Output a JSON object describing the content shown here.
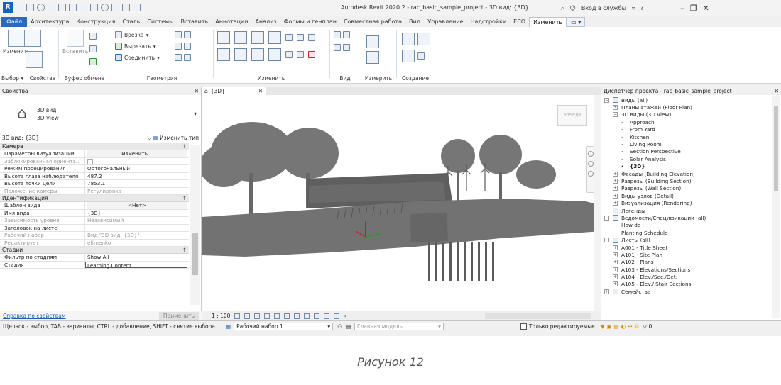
{
  "window": {
    "title": "Autodesk Revit 2020.2 - rac_basic_sample_project - 3D вид: {3D}",
    "signin": "Вход в службы",
    "help": "?"
  },
  "ribbon": {
    "tabs": [
      "Файл",
      "Архитектура",
      "Конструкция",
      "Сталь",
      "Системы",
      "Вставить",
      "Аннотации",
      "Анализ",
      "Формы и генплан",
      "Совместная работа",
      "Вид",
      "Управление",
      "Надстройки",
      "ECO",
      "Изменить"
    ],
    "active_tab": "Изменить",
    "select": {
      "modify_label": "Изменить",
      "group_label": "Выбор",
      "dropdown": "▾"
    },
    "properties_group": "Свойства",
    "clipboard": {
      "paste_label": "Вставить",
      "group_label": "Буфер обмена"
    },
    "geometry": {
      "cope": "Врезка",
      "cut": "Вырезать",
      "join": "Соединить",
      "group_label": "Геометрия"
    },
    "modify_group": "Изменить",
    "view_group": "Вид",
    "measure_group": "Измерить",
    "create_group": "Создание"
  },
  "properties": {
    "header": "Свойства",
    "type_name_1": "3D вид",
    "type_name_2": "3D View",
    "selector": "3D вид: {3D}",
    "edit_type": "Изменить тип",
    "sections": [
      {
        "name": "Камера",
        "rows": [
          {
            "key": "Параметры визуализации",
            "value": "Изменить...",
            "style": "button"
          },
          {
            "key": "Заблокированная ориента...",
            "value": "",
            "style": "checkbox",
            "gray": true
          },
          {
            "key": "Режим проецирования",
            "value": "Ортогональный"
          },
          {
            "key": "Высота глаза наблюдателя",
            "value": "487.2"
          },
          {
            "key": "Высота точки цели",
            "value": "7853.1"
          },
          {
            "key": "Положение камеры",
            "value": "Регулировка",
            "gray": true
          }
        ]
      },
      {
        "name": "Идентификация",
        "rows": [
          {
            "key": "Шаблон вида",
            "value": "<Нет>",
            "style": "button"
          },
          {
            "key": "Имя вида",
            "value": "{3D}"
          },
          {
            "key": "Зависимость уровня",
            "value": "Независимый",
            "gray": true
          },
          {
            "key": "Заголовок на листе",
            "value": ""
          },
          {
            "key": "Рабочий набор",
            "value": "Вид \"3D вид: {3D}\"",
            "gray": true
          },
          {
            "key": "Редактирует",
            "value": "efimenko",
            "gray": true
          }
        ]
      },
      {
        "name": "Стадии",
        "rows": [
          {
            "key": "Фильтр по стадиям",
            "value": "Show All"
          },
          {
            "key": "Стадия",
            "value": "Learning Content",
            "style": "box"
          }
        ]
      }
    ],
    "help_link": "Справка по свойствам",
    "apply": "Применить"
  },
  "view": {
    "tab_title": "{3D}",
    "scale": "1 : 100",
    "viewcube_label": "ВПЕРЕДИ"
  },
  "browser": {
    "header": "Диспетчер проекта - rac_basic_sample_project",
    "items": [
      {
        "label": "Виды (all)",
        "level": 0,
        "toggle": "−",
        "icon": true
      },
      {
        "label": "Планы этажей (Floor Plan)",
        "level": 1,
        "toggle": "+"
      },
      {
        "label": "3D виды (3D View)",
        "level": 1,
        "toggle": "−"
      },
      {
        "label": "Approach",
        "level": 2
      },
      {
        "label": "From Yard",
        "level": 2
      },
      {
        "label": "Kitchen",
        "level": 2
      },
      {
        "label": "Living Room",
        "level": 2
      },
      {
        "label": "Section Perspective",
        "level": 2
      },
      {
        "label": "Solar Analysis",
        "level": 2
      },
      {
        "label": "{3D}",
        "level": 2,
        "bold": true
      },
      {
        "label": "Фасады (Building Elevation)",
        "level": 1,
        "toggle": "+"
      },
      {
        "label": "Разрезы (Building Section)",
        "level": 1,
        "toggle": "+"
      },
      {
        "label": "Разрезы (Wall Section)",
        "level": 1,
        "toggle": "+"
      },
      {
        "label": "Виды узлов (Detail)",
        "level": 1,
        "toggle": "+"
      },
      {
        "label": "Визуализация (Rendering)",
        "level": 1,
        "toggle": "+"
      },
      {
        "label": "Легенды",
        "level": 0,
        "icon": true
      },
      {
        "label": "Ведомости/Спецификации (all)",
        "level": 0,
        "toggle": "−",
        "icon": true
      },
      {
        "label": "How do I",
        "level": 1
      },
      {
        "label": "Planting Schedule",
        "level": 1
      },
      {
        "label": "Листы (all)",
        "level": 0,
        "toggle": "−",
        "icon": true
      },
      {
        "label": "A001 - Title Sheet",
        "level": 1,
        "toggle": "+"
      },
      {
        "label": "A101 - Site Plan",
        "level": 1,
        "toggle": "+"
      },
      {
        "label": "A102 - Plans",
        "level": 1,
        "toggle": "+"
      },
      {
        "label": "A103 - Elevations/Sections",
        "level": 1,
        "toggle": "+"
      },
      {
        "label": "A104 - Elev./Sec./Det.",
        "level": 1,
        "toggle": "+"
      },
      {
        "label": "A105 - Elev./ Stair Sections",
        "level": 1,
        "toggle": "+"
      },
      {
        "label": "Семейства",
        "level": 0,
        "toggle": "+",
        "icon": true
      }
    ]
  },
  "status": {
    "hint": "Щелчок - выбор, TAB - варианты, CTRL - добавление, SHIFT - снятие выбора.",
    "workset": "Рабочий набор 1",
    "design_option": "Главная модель",
    "editable_only": "Только редактируемые",
    "filter_count": ":0"
  },
  "caption": "Рисунок 12",
  "colors": {
    "file_tab": "#2a6bbf",
    "model_gray": "#6e6e6e",
    "link": "#1a5bbd"
  }
}
